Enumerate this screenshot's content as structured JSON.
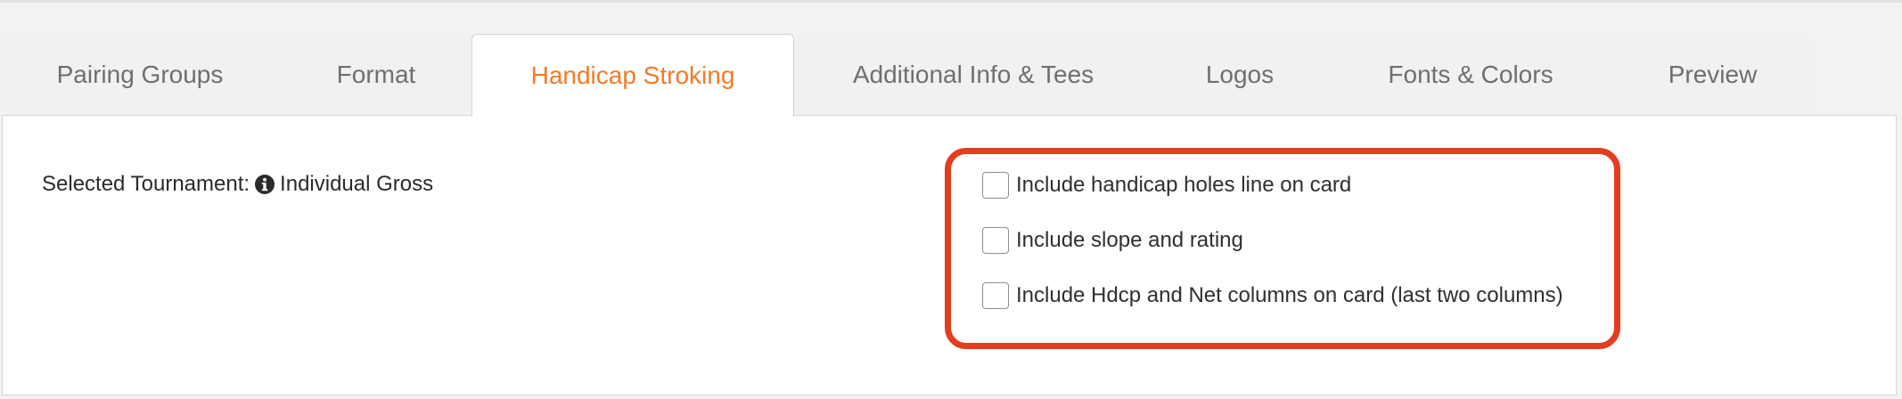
{
  "tabs": [
    {
      "label": "Pairing Groups",
      "active": false
    },
    {
      "label": "Format",
      "active": false
    },
    {
      "label": "Handicap Stroking",
      "active": true
    },
    {
      "label": "Additional Info & Tees",
      "active": false
    },
    {
      "label": "Logos",
      "active": false
    },
    {
      "label": "Fonts & Colors",
      "active": false
    },
    {
      "label": "Preview",
      "active": false
    }
  ],
  "tournament": {
    "label": "Selected Tournament:",
    "info_icon": "info-circle-icon",
    "value": "Individual Gross"
  },
  "options": [
    {
      "label": "Include handicap holes line on card",
      "checked": false
    },
    {
      "label": "Include slope and rating",
      "checked": false
    },
    {
      "label": "Include Hdcp and Net columns on card (last two columns)",
      "checked": false
    }
  ],
  "colors": {
    "active_tab": "#f47a24",
    "highlight": "#e23d1f"
  }
}
